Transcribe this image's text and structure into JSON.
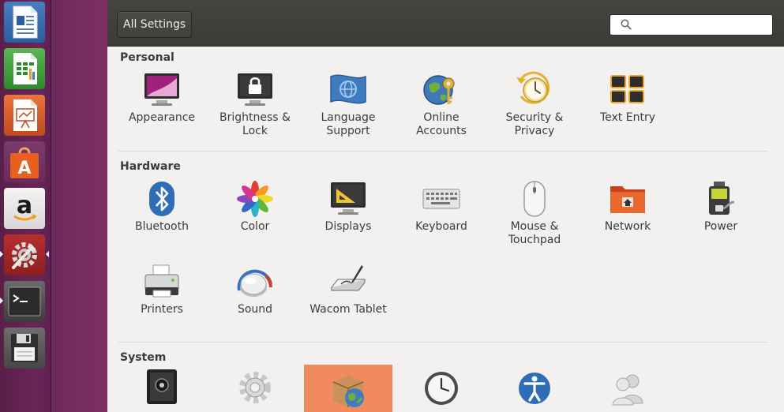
{
  "launcher": {
    "items": [
      {
        "name": "writer"
      },
      {
        "name": "calc"
      },
      {
        "name": "impress"
      },
      {
        "name": "software-center"
      },
      {
        "name": "amazon"
      },
      {
        "name": "system-settings"
      },
      {
        "name": "terminal"
      },
      {
        "name": "save"
      }
    ]
  },
  "toolbar": {
    "all_settings_label": "All Settings",
    "search_placeholder": ""
  },
  "sections": {
    "personal": {
      "title": "Personal",
      "items": [
        {
          "label": "Appearance"
        },
        {
          "label": "Brightness &\nLock"
        },
        {
          "label": "Language\nSupport"
        },
        {
          "label": "Online\nAccounts"
        },
        {
          "label": "Security &\nPrivacy"
        },
        {
          "label": "Text Entry"
        }
      ]
    },
    "hardware": {
      "title": "Hardware",
      "items": [
        {
          "label": "Bluetooth"
        },
        {
          "label": "Color"
        },
        {
          "label": "Displays"
        },
        {
          "label": "Keyboard"
        },
        {
          "label": "Mouse &\nTouchpad"
        },
        {
          "label": "Network"
        },
        {
          "label": "Power"
        },
        {
          "label": "Printers"
        },
        {
          "label": "Sound"
        },
        {
          "label": "Wacom Tablet"
        }
      ]
    },
    "system": {
      "title": "System"
    }
  },
  "colors": {
    "selected": "#ef8b5e",
    "toolbar": "#3f3d39",
    "launcher": "#5e2150"
  }
}
